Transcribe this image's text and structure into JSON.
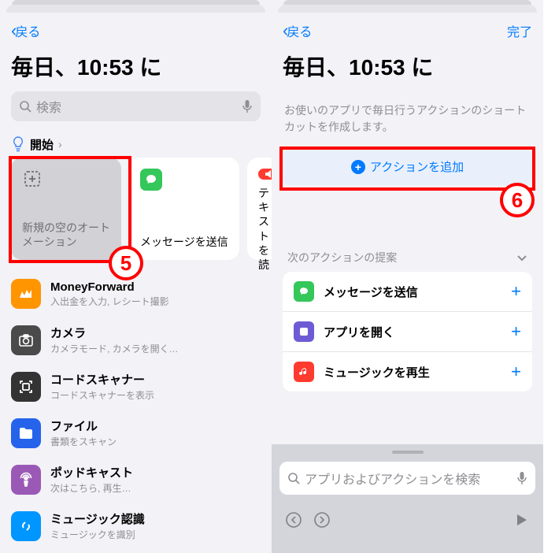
{
  "left": {
    "nav": {
      "back": "戻る"
    },
    "title": "毎日、10:53 に",
    "search": {
      "placeholder": "検索"
    },
    "begin": {
      "label": "開始"
    },
    "cards": [
      {
        "label": "新規の空のオートメーション"
      },
      {
        "label": "メッセージを送信"
      },
      {
        "label": "テキストを読み上げる"
      }
    ],
    "apps": [
      {
        "title": "MoneyForward",
        "sub": "入出金を入力, レシート撮影"
      },
      {
        "title": "カメラ",
        "sub": "カメラモード, カメラを開く…"
      },
      {
        "title": "コードスキャナー",
        "sub": "コードスキャナーを表示"
      },
      {
        "title": "ファイル",
        "sub": "書類をスキャン"
      },
      {
        "title": "ポッドキャスト",
        "sub": "次はこちら, 再生…"
      },
      {
        "title": "ミュージック認識",
        "sub": "ミュージックを識別"
      }
    ],
    "annotation": "5"
  },
  "right": {
    "nav": {
      "back": "戻る",
      "done": "完了"
    },
    "title": "毎日、10:53 に",
    "desc": "お使いのアプリで毎日行うアクションのショートカットを作成します。",
    "add_action": "アクションを追加",
    "section": "次のアクションの提案",
    "suggestions": [
      {
        "label": "メッセージを送信"
      },
      {
        "label": "アプリを開く"
      },
      {
        "label": "ミュージックを再生"
      }
    ],
    "kb_search": "アプリおよびアクションを検索",
    "annotation": "6"
  }
}
